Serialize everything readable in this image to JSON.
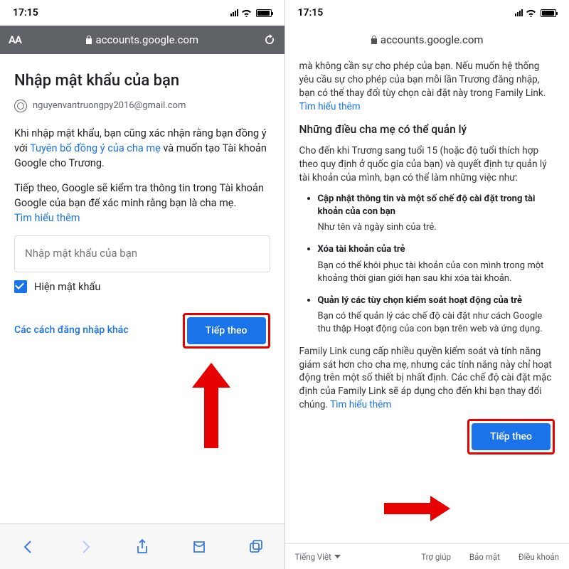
{
  "left": {
    "status": {
      "time": "17:15"
    },
    "url": "accounts.google.com",
    "title": "Nhập mật khẩu của bạn",
    "email": "nguyenvantruongpy2016@gmail.com",
    "p1_a": "Khi nhập mật khẩu, bạn cũng xác nhận rằng bạn đồng ý với ",
    "p1_link": "Tuyên bố đồng ý của cha mẹ",
    "p1_b": " và muốn tạo Tài khoản Google cho Trương.",
    "p2": "Tiếp theo, Google sẽ kiểm tra thông tin trong Tài khoản Google của bạn để xác minh rằng bạn là cha mẹ.",
    "learn_more": "Tìm hiểu thêm",
    "input_placeholder": "Nhập mật khẩu của bạn",
    "show_password": "Hiện mật khẩu",
    "alt_signin": "Các cách đăng nhập khác",
    "next": "Tiếp theo"
  },
  "right": {
    "status": {
      "time": "17:15"
    },
    "url": "accounts.google.com",
    "intro_a": "mà không cần sự cho phép của bạn. Nếu muốn hệ thống yêu cầu sự cho phép của bạn mỗi lần Trương đăng nhập, bạn có thể thay đổi tùy chọn cài đặt này trong Family Link. ",
    "learn_more": "Tìm hiểu thêm",
    "heading": "Những điều cha mẹ có thể quản lý",
    "p_age": "Cho đến khi Trương sang tuổi 15 (hoặc độ tuổi thích hợp theo quy định ở quốc gia của bạn) và quyết định tự quản lý tài khoản của mình, bạn có thể làm những việc như:",
    "bullets": [
      {
        "title": "Cập nhật thông tin và một số chế độ cài đặt trong tài khoản của con bạn",
        "desc": "Như tên và ngày sinh của trẻ."
      },
      {
        "title": "Xóa tài khoản của trẻ",
        "desc": "Bạn có thể khôi phục tài khoản của con mình trong một khoảng thời gian giới hạn sau khi xóa tài khoản."
      },
      {
        "title": "Quản lý các tùy chọn kiểm soát hoạt động của trẻ",
        "desc": "Bạn có thể quản lý các chế độ cài đặt như cách Google thu thập Hoạt động của con bạn trên web và ứng dụng."
      }
    ],
    "p_family": "Family Link cung cấp nhiều quyền kiểm soát và tính năng giám sát hơn cho cha mẹ, nhưng các tính năng này chỉ hoạt động trên một số thiết bị nhất định. Các chế độ cài đặt mặc định của Family Link sẽ áp dụng cho đến khi bạn thay đổi chúng. ",
    "next": "Tiếp theo",
    "footer": {
      "lang": "Tiếng Việt",
      "help": "Trợ giúp",
      "privacy": "Bảo mật",
      "terms": "Điều khoản"
    }
  }
}
